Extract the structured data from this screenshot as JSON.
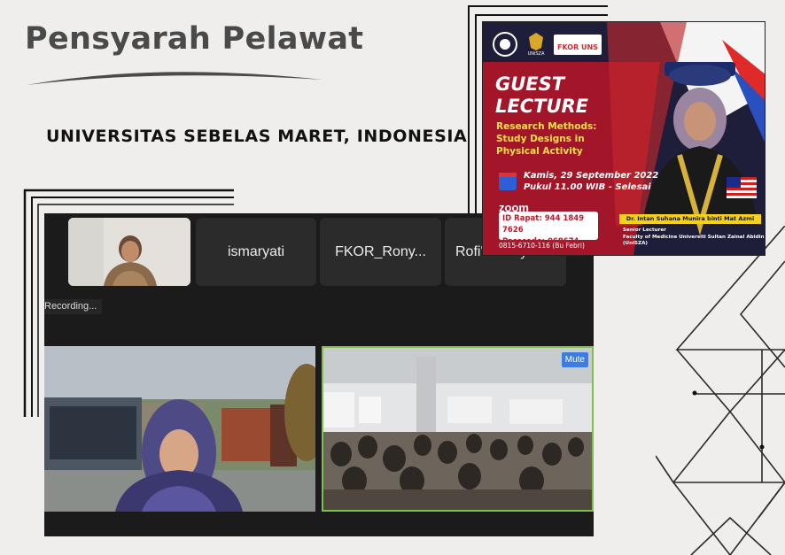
{
  "header": {
    "title": "Pensyarah Pelawat",
    "subtitle": "UNIVERSITAS SEBELAS MARET, INDONESIA"
  },
  "zoom": {
    "participants": [
      {
        "name": "ismaryati"
      },
      {
        "name": "FKOR_Rony..."
      },
      {
        "name": "Rofi' Kurniyah"
      }
    ],
    "recording_label": "Recording...",
    "mute_label": "Mute"
  },
  "poster": {
    "logos": [
      "UNiSZA",
      "FKOR UNS"
    ],
    "guest_line1": "GUEST",
    "guest_line2": "LECTURE",
    "topic_line1": "Research Methods:",
    "topic_line2": "Study Designs in",
    "topic_line3": "Physical Activity",
    "date_line": "Kamis, 29 September 2022",
    "time_line": "Pukul 11.00 WIB - Selesai",
    "zoom_label": "zoom",
    "meeting_id": "ID Rapat: 944 1849 7626",
    "passcode": "Passcode: 068674",
    "phone": "0815-6710-116 (Bu Febri)",
    "speaker_name": "Dr. Intan Suhana Munira binti Mat Azmi",
    "speaker_role1": "Senior Lecturer",
    "speaker_role2": "Faculty of Medicine Universiti Sultan Zainal Abidin",
    "speaker_role3": "(UniSZA)"
  },
  "colors": {
    "background": "#efeeec",
    "title": "#4a4a4a",
    "poster_red": "#a3162a",
    "poster_navy": "#1e1e3a",
    "poster_yellow": "#f5d11a",
    "zoom_dark": "#1b1b1b",
    "speaker_border": "#7fbf4b"
  }
}
